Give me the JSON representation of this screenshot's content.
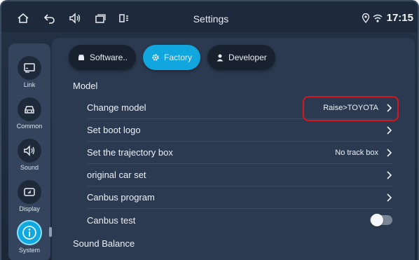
{
  "statusbar": {
    "title": "Settings",
    "time": "17:15",
    "icons": [
      "home-icon",
      "back-icon",
      "volume-icon",
      "recent-apps-icon",
      "split-screen-icon",
      "location-icon",
      "wifi-icon"
    ]
  },
  "sidebar": {
    "items": [
      {
        "label": "Link",
        "icon": "link-icon",
        "active": false
      },
      {
        "label": "Common",
        "icon": "car-icon",
        "active": false
      },
      {
        "label": "Sound",
        "icon": "speaker-icon",
        "active": false
      },
      {
        "label": "Display",
        "icon": "display-icon",
        "active": false
      },
      {
        "label": "System",
        "icon": "info-icon",
        "active": true
      }
    ]
  },
  "tabs": [
    {
      "label": "Software..",
      "icon": "android-icon",
      "active": false
    },
    {
      "label": "Factory",
      "icon": "gear-icon",
      "active": true
    },
    {
      "label": "Developer",
      "icon": "person-icon",
      "active": false
    }
  ],
  "sections": {
    "model": "Model",
    "sound_balance": "Sound Balance"
  },
  "rows": [
    {
      "label": "Change model",
      "value": "Raise>TOYOTA",
      "control": "chevron"
    },
    {
      "label": "Set boot logo",
      "value": "",
      "control": "chevron"
    },
    {
      "label": "Set the trajectory box",
      "value": "No track box",
      "control": "chevron"
    },
    {
      "label": "original car set",
      "value": "",
      "control": "chevron"
    },
    {
      "label": "Canbus program",
      "value": "",
      "control": "chevron"
    },
    {
      "label": "Canbus test",
      "value": "",
      "control": "toggle",
      "toggle_on": false
    }
  ],
  "colors": {
    "accent": "#12a6de",
    "highlight_border": "#d8161f"
  }
}
